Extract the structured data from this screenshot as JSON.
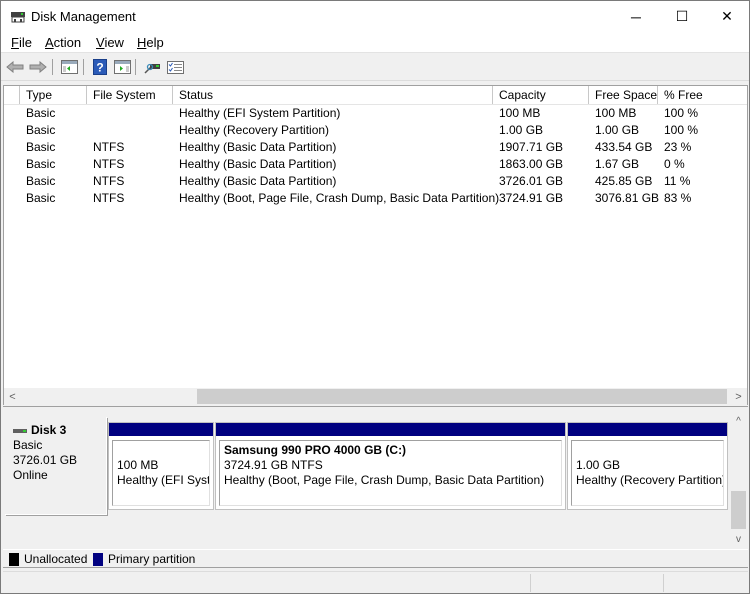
{
  "window": {
    "title": "Disk Management",
    "controls": {
      "minimize": "─",
      "maximize": "☐",
      "close": "✕"
    }
  },
  "menu": [
    {
      "label": "File",
      "accel": "F",
      "rest": "ile"
    },
    {
      "label": "Action",
      "accel": "A",
      "rest": "ction"
    },
    {
      "label": "View",
      "accel": "V",
      "rest": "iew"
    },
    {
      "label": "Help",
      "accel": "H",
      "rest": "elp"
    }
  ],
  "toolbar": {
    "buttons": [
      "back-icon",
      "forward-icon",
      "show-hide-console-tree-icon",
      "help-icon",
      "show-hide-action-pane-icon",
      "connect-icon",
      "properties-icon"
    ]
  },
  "volume_list": {
    "columns": [
      "Type",
      "File System",
      "Status",
      "Capacity",
      "Free Space",
      "% Free"
    ],
    "rows": [
      {
        "type": "Basic",
        "fs": "",
        "status": "Healthy (EFI System Partition)",
        "capacity": "100 MB",
        "free": "100 MB",
        "pct": "100 %"
      },
      {
        "type": "Basic",
        "fs": "",
        "status": "Healthy (Recovery Partition)",
        "capacity": "1.00 GB",
        "free": "1.00 GB",
        "pct": "100 %"
      },
      {
        "type": "Basic",
        "fs": "NTFS",
        "status": "Healthy (Basic Data Partition)",
        "capacity": "1907.71 GB",
        "free": "433.54 GB",
        "pct": "23 %"
      },
      {
        "type": "Basic",
        "fs": "NTFS",
        "status": "Healthy (Basic Data Partition)",
        "capacity": "1863.00 GB",
        "free": "1.67 GB",
        "pct": "0 %"
      },
      {
        "type": "Basic",
        "fs": "NTFS",
        "status": "Healthy (Basic Data Partition)",
        "capacity": "3726.01 GB",
        "free": "425.85 GB",
        "pct": "11 %"
      },
      {
        "type": "Basic",
        "fs": "NTFS",
        "status": "Healthy (Boot, Page File, Crash Dump, Basic Data Partition)",
        "capacity": "3724.91 GB",
        "free": "3076.81 GB",
        "pct": "83 %"
      }
    ],
    "scroll_left": "<",
    "scroll_right": ">"
  },
  "disk": {
    "name": "Disk 3",
    "type": "Basic",
    "size": "3726.01 GB",
    "state": "Online",
    "partitions": [
      {
        "title": "",
        "line1": "100 MB",
        "line2": "Healthy (EFI System Partition)"
      },
      {
        "title": "Samsung 990 PRO 4000 GB  (C:)",
        "line1": "3724.91 GB NTFS",
        "line2": "Healthy (Boot, Page File, Crash Dump, Basic Data Partition)"
      },
      {
        "title": "",
        "line1": "1.00 GB",
        "line2": "Healthy (Recovery Partition)"
      }
    ],
    "scroll_up": "^",
    "scroll_down": "v"
  },
  "legend": {
    "items": [
      {
        "label": "Unallocated",
        "color": "#000000"
      },
      {
        "label": "Primary partition",
        "color": "#000080"
      }
    ]
  }
}
